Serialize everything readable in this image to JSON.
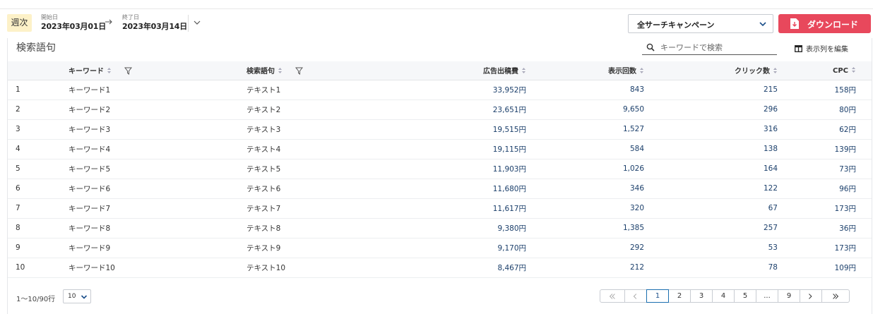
{
  "header": {
    "period": "週次",
    "start_label": "開始日",
    "start_value": "2023年03月01日",
    "end_label": "終了日",
    "end_value": "2023年03月14日",
    "campaign": "全サーチキャンペーン",
    "download_label": "ダウンロード",
    "accent_color": "#e8485c"
  },
  "card": {
    "title": "検索語句",
    "search_placeholder": "キーワードで検索",
    "edit_columns_label": "表示列を編集"
  },
  "table": {
    "columns": [
      "",
      "キーワード",
      "検索語句",
      "広告出稿費",
      "表示回数",
      "クリック数",
      "CPC"
    ],
    "rows": [
      [
        "1",
        "キーワード1",
        "テキスト1",
        "33,952円",
        "843",
        "215",
        "158円"
      ],
      [
        "2",
        "キーワード2",
        "テキスト2",
        "23,651円",
        "9,650",
        "296",
        "80円"
      ],
      [
        "3",
        "キーワード3",
        "テキスト3",
        "19,515円",
        "1,527",
        "316",
        "62円"
      ],
      [
        "4",
        "キーワード4",
        "テキスト4",
        "19,115円",
        "584",
        "138",
        "139円"
      ],
      [
        "5",
        "キーワード5",
        "テキスト5",
        "11,903円",
        "1,026",
        "164",
        "73円"
      ],
      [
        "6",
        "キーワード6",
        "テキスト6",
        "11,680円",
        "346",
        "122",
        "96円"
      ],
      [
        "7",
        "キーワード7",
        "テキスト7",
        "11,617円",
        "320",
        "67",
        "173円"
      ],
      [
        "8",
        "キーワード8",
        "テキスト8",
        "9,380円",
        "1,385",
        "257",
        "36円"
      ],
      [
        "9",
        "キーワード9",
        "テキスト9",
        "9,170円",
        "292",
        "53",
        "173円"
      ],
      [
        "10",
        "キーワード10",
        "テキスト10",
        "8,467円",
        "212",
        "78",
        "109円"
      ]
    ]
  },
  "footer": {
    "range_text": "1〜10/90行",
    "per_page": "10",
    "pages": [
      {
        "label": "<<",
        "icon": "double-chevron-left-icon",
        "state": "disabled",
        "w": 36
      },
      {
        "label": "<",
        "icon": "chevron-left-icon",
        "state": "disabled",
        "w": 32
      },
      {
        "label": "1",
        "state": "active",
        "w": 32
      },
      {
        "label": "2",
        "state": "normal",
        "w": 32
      },
      {
        "label": "3",
        "state": "normal",
        "w": 32
      },
      {
        "label": "4",
        "state": "normal",
        "w": 32
      },
      {
        "label": "5",
        "state": "normal",
        "w": 32
      },
      {
        "label": "...",
        "state": "normal",
        "w": 32
      },
      {
        "label": "9",
        "state": "normal",
        "w": 32
      },
      {
        "label": ">",
        "icon": "chevron-right-icon",
        "state": "normal",
        "w": 32
      },
      {
        "label": ">>",
        "icon": "double-chevron-right-icon",
        "state": "normal",
        "w": 40
      }
    ]
  }
}
